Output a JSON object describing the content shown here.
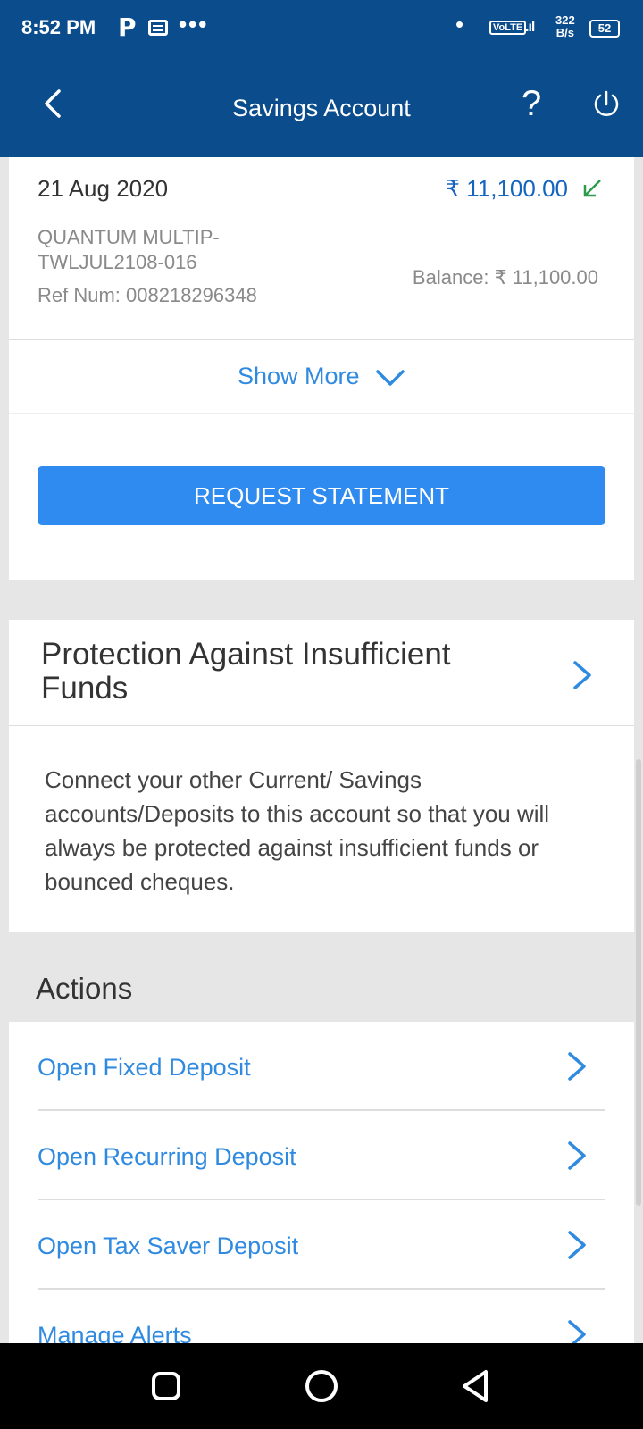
{
  "status_bar": {
    "time": "8:52 PM",
    "app_icon": "P",
    "dots": "•••",
    "dot": "•",
    "volte": "VoLTE",
    "speed_value": "322",
    "speed_unit": "B/s",
    "battery": "52"
  },
  "header": {
    "title": "Savings Account",
    "help_label": "?",
    "back_icon": "chevron-left-icon",
    "power_icon": "power-icon"
  },
  "transaction": {
    "date": "21 Aug 2020",
    "amount": "₹ 11,100.00",
    "direction_icon": "arrow-down-left-icon",
    "description": "QUANTUM MULTIP-TWLJUL2108-016",
    "ref": "Ref Num: 008218296348",
    "balance": "Balance: ₹ 11,100.00"
  },
  "show_more": {
    "label": "Show More"
  },
  "request_statement": {
    "label": "REQUEST STATEMENT"
  },
  "protection": {
    "title": "Protection Against Insufficient Funds",
    "description": "Connect your other Current/ Savings accounts/Deposits to this account so that you will always be protected against insufficient funds or bounced cheques."
  },
  "actions": {
    "heading": "Actions",
    "items": [
      {
        "label": "Open Fixed Deposit"
      },
      {
        "label": "Open Recurring Deposit"
      },
      {
        "label": "Open Tax Saver Deposit"
      },
      {
        "label": "Manage Alerts"
      }
    ]
  },
  "colors": {
    "header_bg": "#0b4c8c",
    "accent_blue": "#2f8ae0",
    "button_blue": "#2f8bf0",
    "credit_green": "#2e9b4a"
  }
}
